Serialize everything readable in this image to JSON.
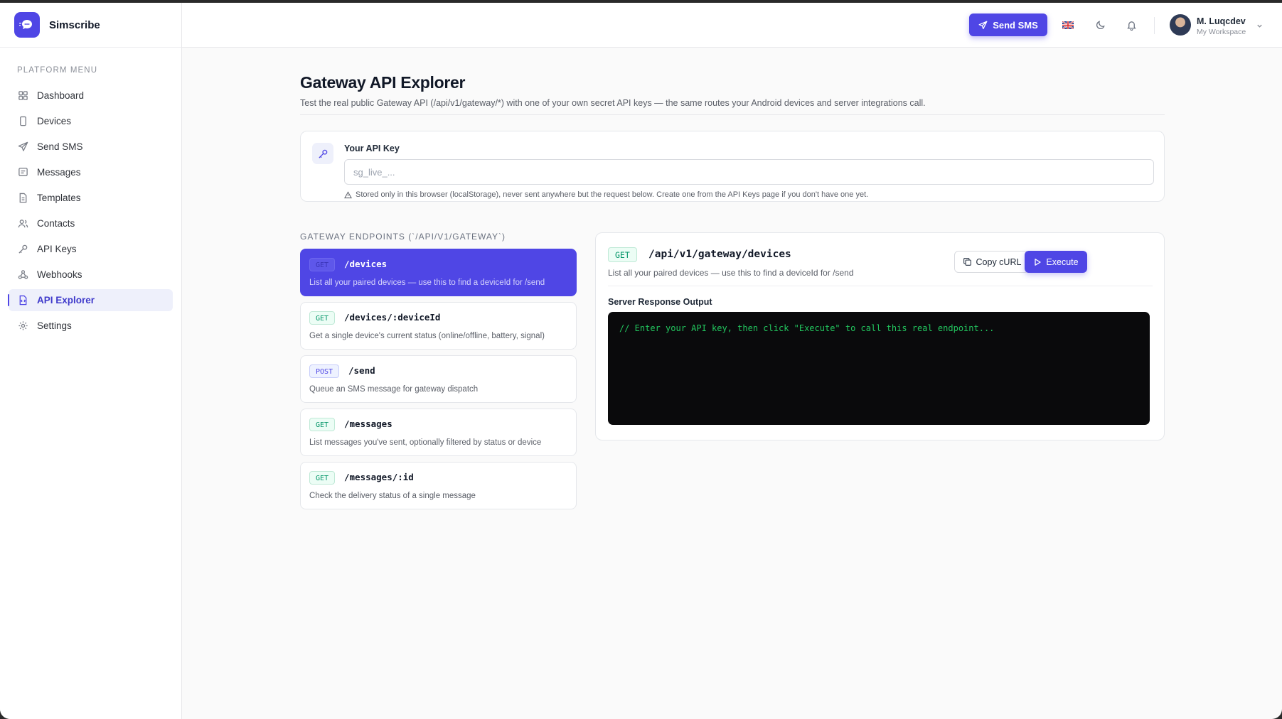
{
  "app": {
    "name": "Simscribe"
  },
  "sidebar": {
    "menu_title": "PLATFORM MENU",
    "items": [
      {
        "label": "Dashboard",
        "icon": "dashboard-icon"
      },
      {
        "label": "Devices",
        "icon": "device-icon"
      },
      {
        "label": "Send SMS",
        "icon": "send-icon"
      },
      {
        "label": "Messages",
        "icon": "message-icon"
      },
      {
        "label": "Templates",
        "icon": "template-icon"
      },
      {
        "label": "Contacts",
        "icon": "contacts-icon"
      },
      {
        "label": "API Keys",
        "icon": "key-icon"
      },
      {
        "label": "Webhooks",
        "icon": "webhook-icon"
      },
      {
        "label": "API Explorer",
        "icon": "api-explorer-icon",
        "active": true
      },
      {
        "label": "Settings",
        "icon": "gear-icon"
      }
    ]
  },
  "topbar": {
    "send_label": "Send SMS",
    "user_name": "M. Luqcdev",
    "workspace": "My Workspace"
  },
  "page": {
    "title": "Gateway API Explorer",
    "subtitle": "Test the real public Gateway API (/api/v1/gateway/*) with one of your own secret API keys — the same routes your Android devices and server integrations call."
  },
  "api_key": {
    "label": "Your API Key",
    "value": "",
    "placeholder": "sg_live_...",
    "note": "Stored only in this browser (localStorage), never sent anywhere but the request below. Create one from the API Keys page if you don't have one yet."
  },
  "endpoints_title": "GATEWAY ENDPOINTS (`/API/V1/GATEWAY`)",
  "endpoints": [
    {
      "method": "GET",
      "path": "/devices",
      "desc": "List all your paired devices — use this to find a deviceId for /send",
      "active": true
    },
    {
      "method": "GET",
      "path": "/devices/:deviceId",
      "desc": "Get a single device's current status (online/offline, battery, signal)"
    },
    {
      "method": "POST",
      "path": "/send",
      "desc": "Queue an SMS message for gateway dispatch"
    },
    {
      "method": "GET",
      "path": "/messages",
      "desc": "List messages you've sent, optionally filtered by status or device"
    },
    {
      "method": "GET",
      "path": "/messages/:id",
      "desc": "Check the delivery status of a single message"
    }
  ],
  "detail": {
    "method": "GET",
    "path": "/api/v1/gateway/devices",
    "desc": "List all your paired devices — use this to find a deviceId for /send",
    "copy_label": "Copy cURL",
    "execute_label": "Execute",
    "response_label": "Server Response Output",
    "response_text": "// Enter your API key, then click \"Execute\" to call this real endpoint..."
  },
  "colors": {
    "accent": "#4f46e5",
    "get_badge": "#059669",
    "console_text": "#22c55e"
  }
}
